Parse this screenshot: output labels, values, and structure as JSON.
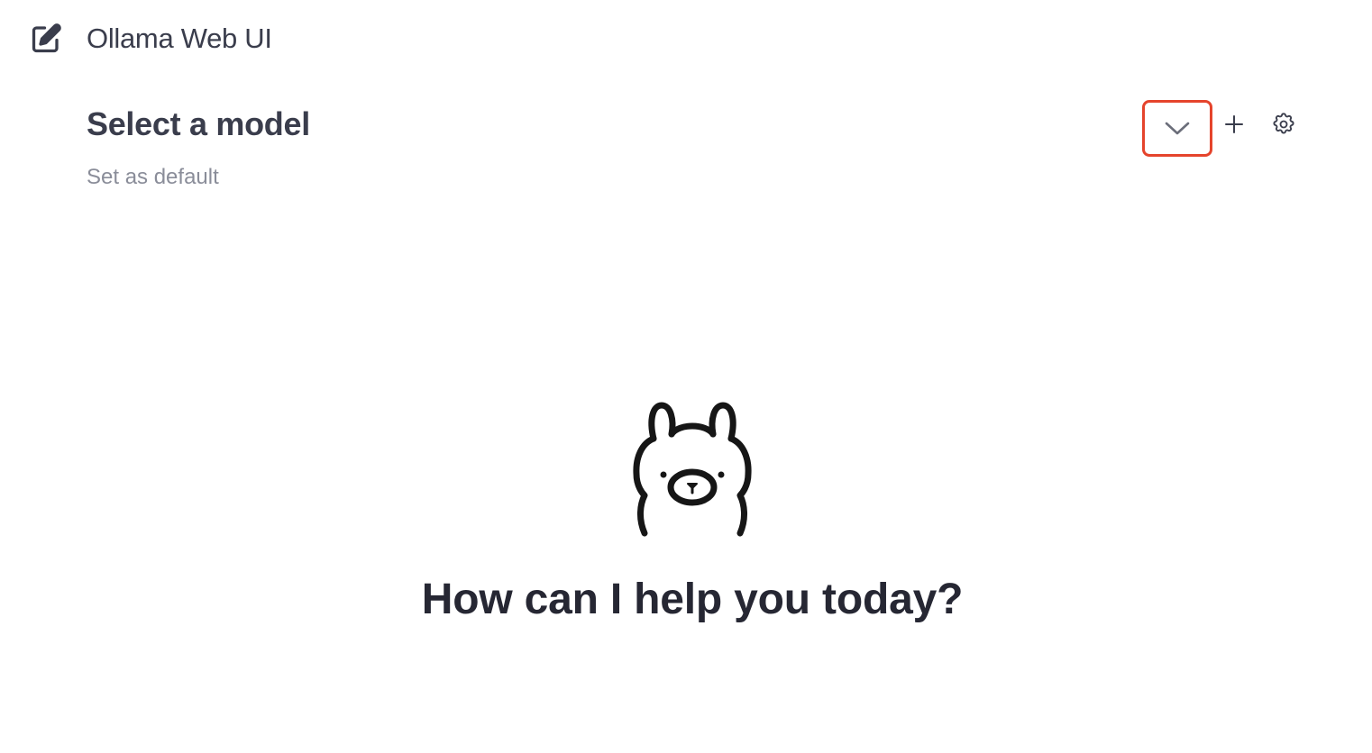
{
  "header": {
    "app_title": "Ollama Web UI",
    "new_chat_icon": "edit-icon"
  },
  "model_selector": {
    "placeholder": "Select a model",
    "set_default_label": "Set as default",
    "dropdown_icon": "chevron-down-icon",
    "add_icon": "plus-icon",
    "settings_icon": "gear-icon",
    "highlight_color": "#e5442c"
  },
  "main": {
    "logo_icon": "ollama-llama-logo",
    "greeting": "How can I help you today?"
  }
}
